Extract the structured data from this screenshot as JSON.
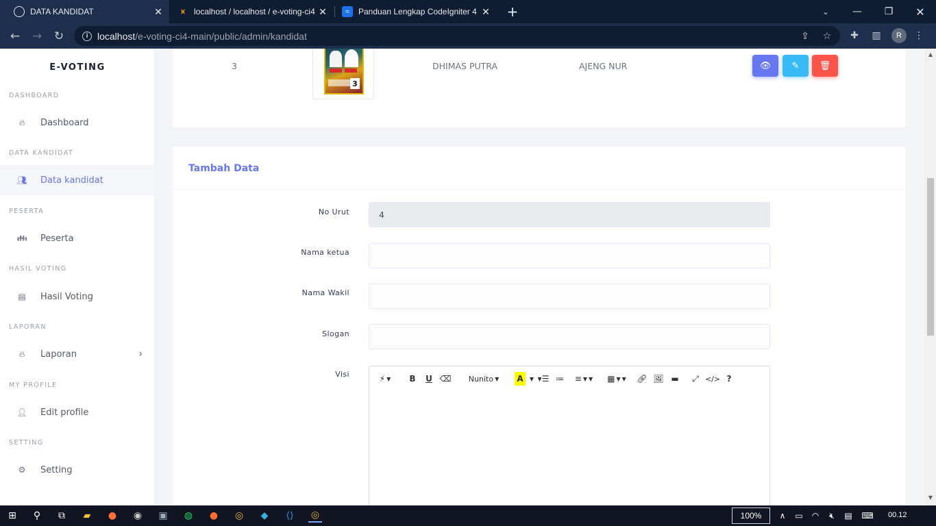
{
  "browser": {
    "tabs": [
      {
        "title": "DATA KANDIDAT",
        "favicon": "globe-icon"
      },
      {
        "title": "localhost / localhost / e-voting-ci4",
        "favicon": "phpmyadmin-icon"
      },
      {
        "title": "Panduan Lengkap CodeIgniter 4",
        "favicon": "codeigniter-guide-icon"
      }
    ],
    "url_host": "localhost",
    "url_path": "/e-voting-ci4-main/public/admin/kandidat",
    "profile_initial": "R"
  },
  "sidebar": {
    "brand": "E-VOTING",
    "sections": [
      {
        "heading": "DASHBOARD",
        "item": {
          "label": "Dashboard",
          "icon": "fire-icon"
        }
      },
      {
        "heading": "DATA KANDIDAT",
        "item": {
          "label": "Data kandidat",
          "icon": "users-icon"
        }
      },
      {
        "heading": "PESERTA",
        "item": {
          "label": "Peserta",
          "icon": "user-group-icon"
        }
      },
      {
        "heading": "HASIL VOTING",
        "item": {
          "label": "Hasil Voting",
          "icon": "document-icon"
        }
      },
      {
        "heading": "LAPORAN",
        "item": {
          "label": "Laporan",
          "icon": "fire-icon"
        }
      },
      {
        "heading": "MY PROFILE",
        "item": {
          "label": "Edit profile",
          "icon": "user-edit-icon"
        }
      },
      {
        "heading": "SETTING",
        "item": {
          "label": "Setting",
          "icon": "cogs-icon"
        }
      }
    ]
  },
  "table_row": {
    "no_urut": "3",
    "ketua": "DHIMAS PUTRA",
    "wakil": "AJENG NUR"
  },
  "form": {
    "title": "Tambah Data",
    "fields": [
      {
        "label": "No Urut",
        "value": "4"
      },
      {
        "label": "Nama ketua",
        "value": ""
      },
      {
        "label": "Nama Wakil",
        "value": ""
      },
      {
        "label": "Slogan",
        "value": ""
      },
      {
        "label": "Visi",
        "value": ""
      }
    ],
    "editor_font": "Nunito"
  },
  "taskbar": {
    "zoom": "100%",
    "clock": "00.12"
  },
  "colors": {
    "primary": "#6777ef",
    "info": "#3abaf4",
    "danger": "#fc544b"
  }
}
